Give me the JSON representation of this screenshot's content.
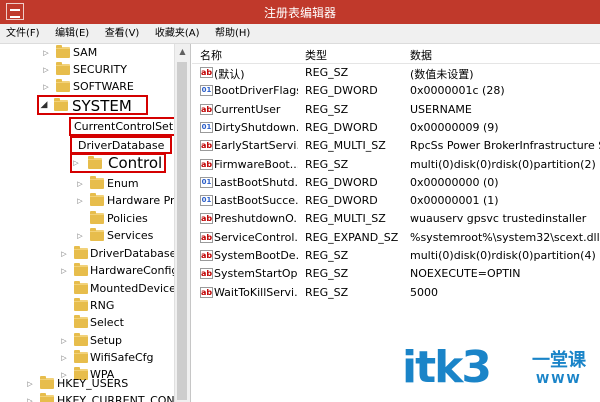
{
  "window": {
    "title": "注册表编辑器"
  },
  "menu": [
    "文件(F)",
    "编辑(E)",
    "查看(V)",
    "收藏夹(A)",
    "帮助(H)"
  ],
  "tree": [
    {
      "label": "SAM"
    },
    {
      "label": "SECURITY"
    },
    {
      "label": "SOFTWARE"
    },
    {
      "label": "SYSTEM"
    },
    {
      "label": "CurrentControlSet"
    },
    {
      "label": "DriverDatabase"
    },
    {
      "label": "Control"
    },
    {
      "label": "Enum"
    },
    {
      "label": "Hardware Pro"
    },
    {
      "label": "Policies"
    },
    {
      "label": "Services"
    },
    {
      "label": "DriverDatabase"
    },
    {
      "label": "HardwareConfig"
    },
    {
      "label": "MountedDevices"
    },
    {
      "label": "RNG"
    },
    {
      "label": "Select"
    },
    {
      "label": "Setup"
    },
    {
      "label": "WifiSafeCfg"
    },
    {
      "label": "WPA"
    },
    {
      "label": "HKEY_USERS"
    },
    {
      "label": "HKEY_CURRENT_CONF"
    }
  ],
  "columns": {
    "name": "名称",
    "type": "类型",
    "data": "数据"
  },
  "values": [
    {
      "icon": "ab",
      "name": "(默认)",
      "type": "REG_SZ",
      "data": "(数值未设置)"
    },
    {
      "icon": "bin",
      "name": "BootDriverFlags",
      "type": "REG_DWORD",
      "data": "0x0000001c (28)"
    },
    {
      "icon": "ab",
      "name": "CurrentUser",
      "type": "REG_SZ",
      "data": "USERNAME"
    },
    {
      "icon": "bin",
      "name": "DirtyShutdown...",
      "type": "REG_DWORD",
      "data": "0x00000009 (9)"
    },
    {
      "icon": "ab",
      "name": "EarlyStartServi...",
      "type": "REG_MULTI_SZ",
      "data": "RpcSs Power BrokerInfrastructure Sys"
    },
    {
      "icon": "ab",
      "name": "FirmwareBoot...",
      "type": "REG_SZ",
      "data": "multi(0)disk(0)rdisk(0)partition(2)"
    },
    {
      "icon": "bin",
      "name": "LastBootShutd...",
      "type": "REG_DWORD",
      "data": "0x00000000 (0)"
    },
    {
      "icon": "bin",
      "name": "LastBootSucce...",
      "type": "REG_DWORD",
      "data": "0x00000001 (1)"
    },
    {
      "icon": "ab",
      "name": "PreshutdownO...",
      "type": "REG_MULTI_SZ",
      "data": "wuauserv gpsvc trustedinstaller"
    },
    {
      "icon": "ab",
      "name": "ServiceControl...",
      "type": "REG_EXPAND_SZ",
      "data": "%systemroot%\\system32\\scext.dll"
    },
    {
      "icon": "ab",
      "name": "SystemBootDe...",
      "type": "REG_SZ",
      "data": "multi(0)disk(0)rdisk(0)partition(4)"
    },
    {
      "icon": "ab",
      "name": "SystemStartOp...",
      "type": "REG_SZ",
      "data": "NOEXECUTE=OPTIN"
    },
    {
      "icon": "ab",
      "name": "WaitToKillServi...",
      "type": "REG_SZ",
      "data": "5000"
    }
  ],
  "watermark": {
    "main": "itk3",
    "cn": "一堂课",
    "en": "WWW"
  },
  "colors": {
    "titlebar": "#c0392b",
    "highlight": "#d40000",
    "folder": "#e7bd4c",
    "watermark": "#1a84c8"
  }
}
